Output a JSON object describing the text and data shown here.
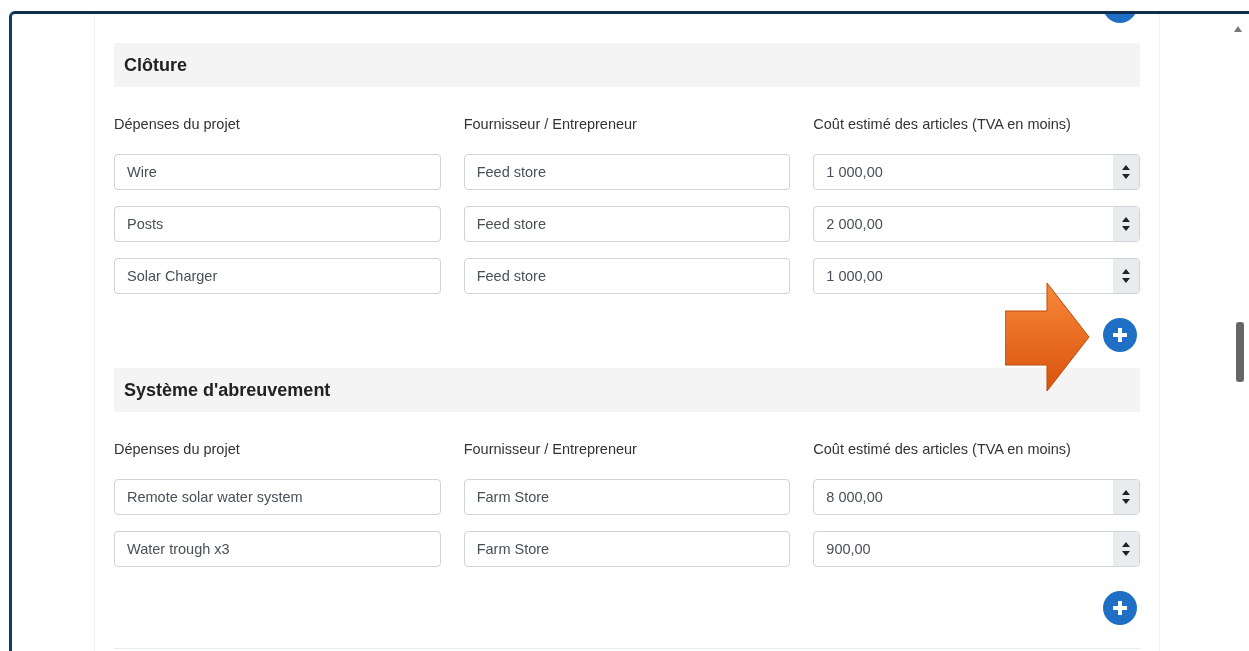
{
  "sections": [
    {
      "title": "Clôture",
      "columns": [
        "Dépenses du projet",
        "Fournisseur / Entrepreneur",
        "Coût estimé des articles (TVA en moins)"
      ],
      "rows": [
        {
          "expense": "Wire",
          "supplier": "Feed store",
          "cost": "1 000,00"
        },
        {
          "expense": "Posts",
          "supplier": "Feed store",
          "cost": "2 000,00"
        },
        {
          "expense": "Solar Charger",
          "supplier": "Feed store",
          "cost": "1 000,00"
        }
      ]
    },
    {
      "title": "Système d'abreuvement",
      "columns": [
        "Dépenses du projet",
        "Fournisseur / Entrepreneur",
        "Coût estimé des articles (TVA en moins)"
      ],
      "rows": [
        {
          "expense": "Remote solar water system",
          "supplier": "Farm Store",
          "cost": "8 000,00"
        },
        {
          "expense": "Water trough x3",
          "supplier": "Farm Store",
          "cost": "900,00"
        }
      ]
    }
  ]
}
